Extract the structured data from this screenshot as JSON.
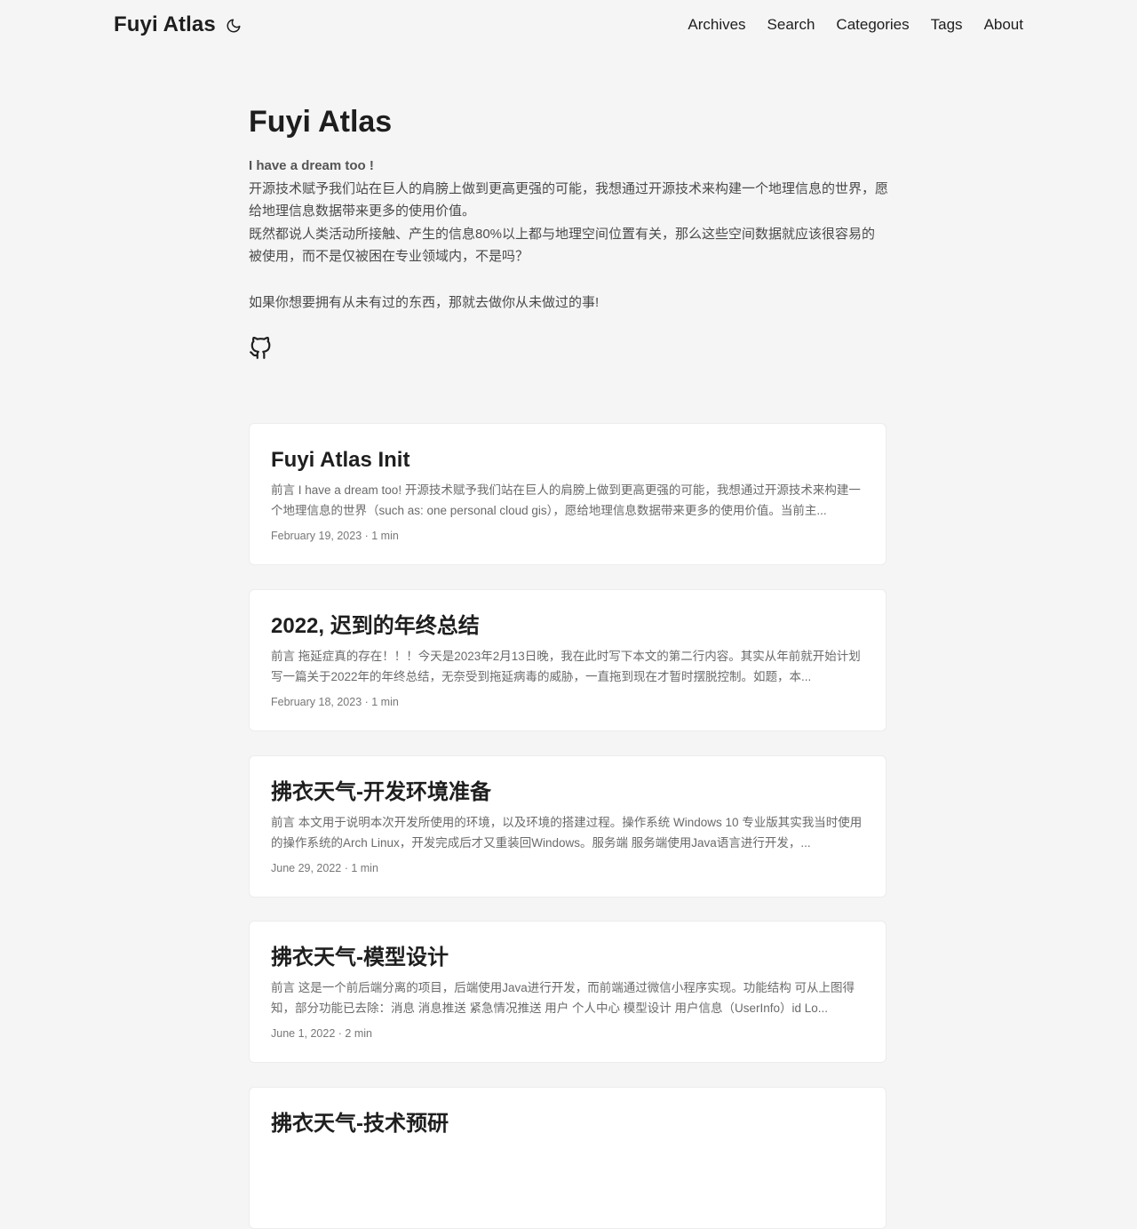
{
  "header": {
    "logo": "Fuyi Atlas",
    "theme_icon": "moon-icon",
    "nav": [
      "Archives",
      "Search",
      "Categories",
      "Tags",
      "About"
    ]
  },
  "profile": {
    "title": "Fuyi Atlas",
    "lead": "I have a dream too !",
    "line1": "开源技术赋予我们站在巨人的肩膀上做到更高更强的可能，我想通过开源技术来构建一个地理信息的世界，愿给地理信息数据带来更多的使用价值。",
    "line2": "既然都说人类活动所接触、产生的信息80%以上都与地理空间位置有关，那么这些空间数据就应该很容易的被使用，而不是仅被困在专业领域内，不是吗？",
    "line3": "如果你想要拥有从未有过的东西，那就去做你从未做过的事!",
    "social_icon": "github-icon"
  },
  "posts": [
    {
      "title": "Fuyi Atlas Init",
      "summary": "前言 I have a dream too! 开源技术赋予我们站在巨人的肩膀上做到更高更强的可能，我想通过开源技术来构建一个地理信息的世界（such as: one personal cloud gis），愿给地理信息数据带来更多的使用价值。当前主...",
      "meta": "February 19, 2023 · 1 min"
    },
    {
      "title": "2022, 迟到的年终总结",
      "summary": "前言 拖延症真的存在！！！今天是2023年2月13日晚，我在此时写下本文的第二行内容。其实从年前就开始计划写一篇关于2022年的年终总结，无奈受到拖延病毒的威胁，一直拖到现在才暂时摆脱控制。如题，本...",
      "meta": "February 18, 2023 · 1 min"
    },
    {
      "title": "拂衣天气-开发环境准备",
      "summary": "前言 本文用于说明本次开发所使用的环境，以及环境的搭建过程。操作系统 Windows 10 专业版其实我当时使用的操作系统的Arch Linux，开发完成后才又重装回Windows。服务端 服务端使用Java语言进行开发，...",
      "meta": "June 29, 2022 · 1 min"
    },
    {
      "title": "拂衣天气-模型设计",
      "summary": "前言 这是一个前后端分离的项目，后端使用Java进行开发，而前端通过微信小程序实现。功能结构 可从上图得知，部分功能已去除：消息 消息推送 紧急情况推送 用户 个人中心 模型设计 用户信息（UserInfo）id Lo...",
      "meta": "June 1, 2022 · 2 min"
    },
    {
      "title": "拂衣天气-技术预研",
      "summary": "",
      "meta": ""
    }
  ]
}
